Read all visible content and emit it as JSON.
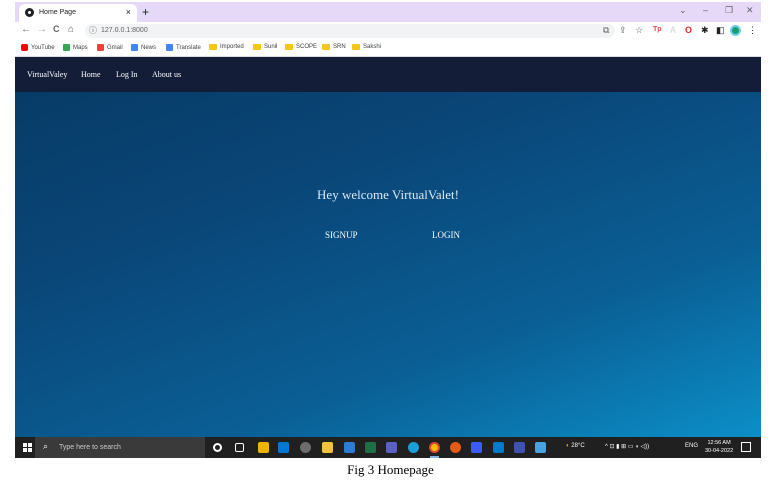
{
  "browser": {
    "tab_title": "Home Page",
    "tab_close": "×",
    "new_tab": "+",
    "window_controls": {
      "chevron": "⌄",
      "minimize": "–",
      "restore": "❐",
      "close": "✕"
    },
    "nav": {
      "back": "←",
      "forward": "→",
      "reload": "C",
      "home": "⌂"
    },
    "url_info": "ⓘ",
    "url": "127.0.0.1:8000",
    "extensions": {
      "translate": "⧉",
      "share": "⇪",
      "star": "☆",
      "tp": "Tp",
      "adobe": "A",
      "opera": "O",
      "puzzle": "✱",
      "sidepanel": "◧",
      "menu": "⋮"
    },
    "bookmarks": [
      {
        "label": "YouTube",
        "icon": "youtube-icon",
        "color": "#ff0000"
      },
      {
        "label": "Maps",
        "icon": "maps-icon",
        "color": "#34a853"
      },
      {
        "label": "Gmail",
        "icon": "gmail-icon",
        "color": "#ea4335"
      },
      {
        "label": "News",
        "icon": "news-icon",
        "color": "#4285f4"
      },
      {
        "label": "Translate",
        "icon": "translate-icon",
        "color": "#4285f4"
      },
      {
        "label": "Imported",
        "icon": "folder-icon"
      },
      {
        "label": "Sunil",
        "icon": "folder-icon"
      },
      {
        "label": "SCOPE",
        "icon": "folder-icon"
      },
      {
        "label": "SRN",
        "icon": "folder-icon"
      },
      {
        "label": "Sakshi",
        "icon": "folder-icon"
      }
    ]
  },
  "site": {
    "nav": {
      "brand": "VirtualValey",
      "home": "Home",
      "login": "Log In",
      "about": "About us"
    },
    "welcome": "Hey welcome VirtualValet!",
    "signup": "SIGNUP",
    "login_button": "LOGIN",
    "colors": {
      "navbar": "#141d38",
      "gradient_start": "#063a63",
      "gradient_end": "#0c8ec7"
    }
  },
  "taskbar": {
    "search_placeholder": "Type here to search",
    "weather": "28°C",
    "language": "ENG",
    "time": "12:56 AM",
    "date": "30-04-2022",
    "tray": "^ ⊡ ▮ ⊞ ▭ ◖ ◁))"
  },
  "caption": "Fig 3 Homepage"
}
